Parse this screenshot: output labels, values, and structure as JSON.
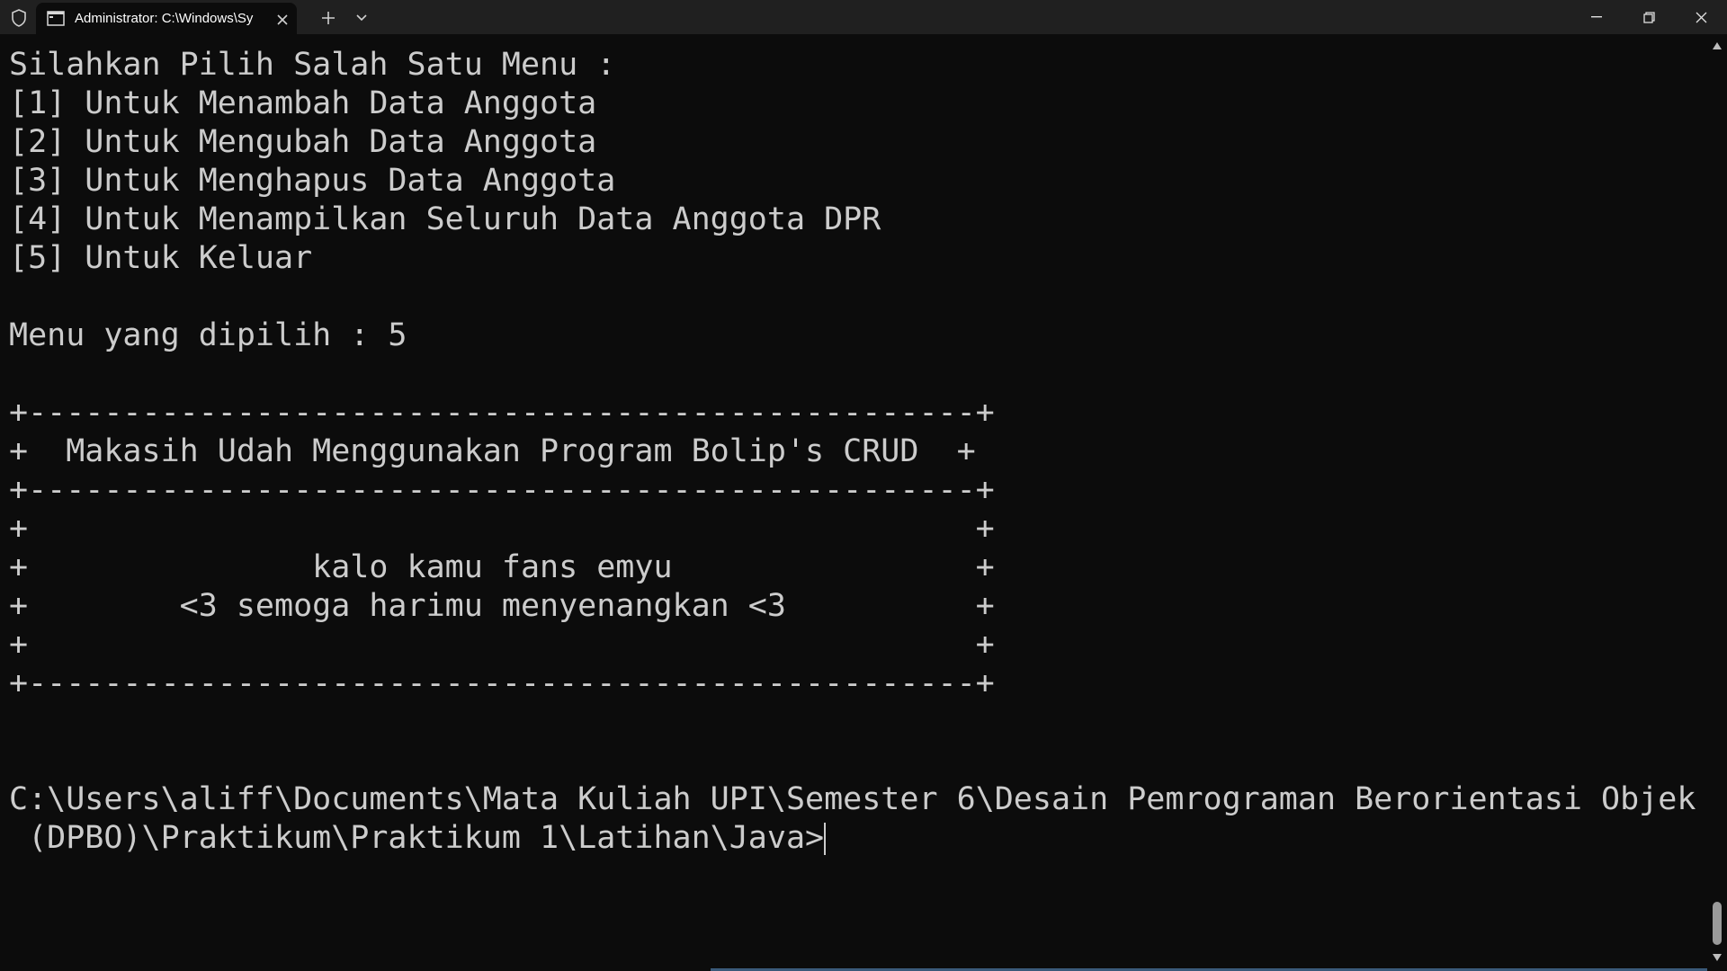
{
  "window": {
    "tab_title": "Administrator: C:\\Windows\\Sy",
    "icons": {
      "shield": "shield-icon",
      "terminal": "terminal-icon",
      "close_tab": "close-icon",
      "new_tab": "plus-icon",
      "dropdown": "chevron-down-icon",
      "minimize": "minimize-icon",
      "maximize": "restore-icon",
      "close": "close-icon"
    }
  },
  "console": {
    "lines": [
      "Silahkan Pilih Salah Satu Menu :",
      "[1] Untuk Menambah Data Anggota",
      "[2] Untuk Mengubah Data Anggota",
      "[3] Untuk Menghapus Data Anggota",
      "[4] Untuk Menampilkan Seluruh Data Anggota DPR",
      "[5] Untuk Keluar",
      "",
      "Menu yang dipilih : 5",
      "",
      "+--------------------------------------------------+",
      "+  Makasih Udah Menggunakan Program Bolip's CRUD  +",
      "+--------------------------------------------------+",
      "+                                                  +",
      "+               kalo kamu fans emyu                +",
      "+        <3 semoga harimu menyenangkan <3          +",
      "+                                                  +",
      "+--------------------------------------------------+",
      "",
      "",
      "C:\\Users\\aliff\\Documents\\Mata Kuliah UPI\\Semester 6\\Desain Pemrograman Berorientasi Objek",
      " (DPBO)\\Praktikum\\Praktikum 1\\Latihan\\Java>"
    ]
  },
  "colors": {
    "console_bg": "#0c0c0c",
    "console_fg": "#cccccc",
    "titlebar_bg": "#202020",
    "scroll_thumb": "#9a9a9a"
  }
}
